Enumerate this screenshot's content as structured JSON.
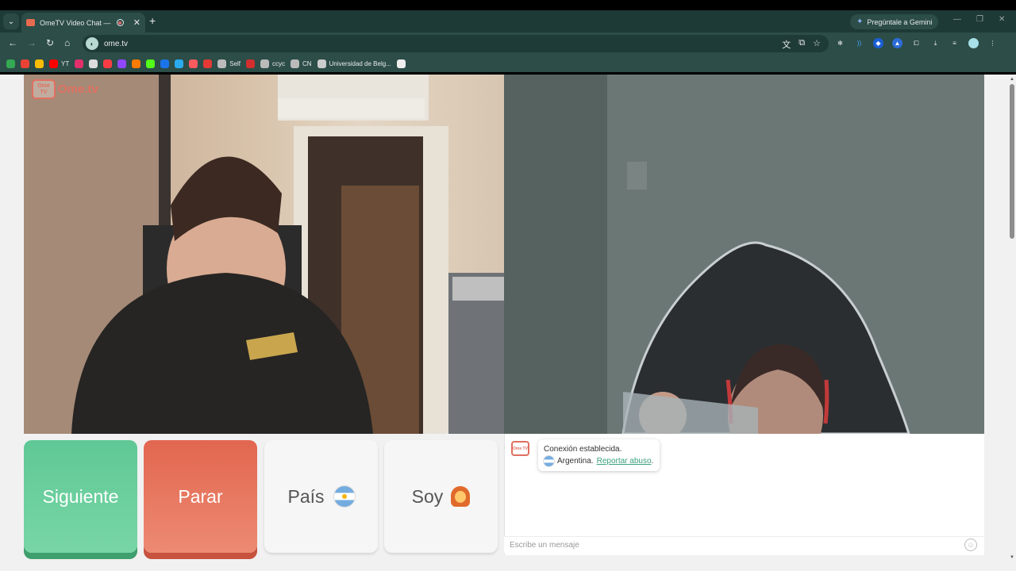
{
  "browser": {
    "tab_title": "OmeTV Video Chat — Ome",
    "new_tab_label": "+",
    "gemini_label": "Pregúntale a Gemini",
    "url": "ome.tv",
    "bookmarks": [
      {
        "label": "",
        "color": "#34a853"
      },
      {
        "label": "",
        "color": "#ea4335"
      },
      {
        "label": "",
        "color": "#fbbc04"
      },
      {
        "label": "YT",
        "color": "#ff0000"
      },
      {
        "label": "",
        "color": "#e1306c"
      },
      {
        "label": "",
        "color": "#dddddd"
      },
      {
        "label": "",
        "color": "#fc3c44"
      },
      {
        "label": "",
        "color": "#9146ff"
      },
      {
        "label": "",
        "color": "#ff7a00"
      },
      {
        "label": "",
        "color": "#53fc18"
      },
      {
        "label": "",
        "color": "#1a73e8"
      },
      {
        "label": "",
        "color": "#2aabee"
      },
      {
        "label": "",
        "color": "#ff5a5f"
      },
      {
        "label": "",
        "color": "#e53935"
      },
      {
        "label": "Self",
        "color": "#bbbbbb"
      },
      {
        "label": "",
        "color": "#d32f2f"
      },
      {
        "label": "ccyc",
        "color": "#bbbbbb"
      },
      {
        "label": "CN",
        "color": "#bbbbbb"
      },
      {
        "label": "Universidad de Belg...",
        "color": "#cccccc"
      },
      {
        "label": "",
        "color": "#eeeeee"
      }
    ]
  },
  "app": {
    "logo_text": "Ome.tv",
    "logo_badge": "Ome TV",
    "buttons": {
      "next": "Siguiente",
      "stop": "Parar",
      "country": "País",
      "soy": "Soy"
    },
    "chat": {
      "status": "Conexión establecida.",
      "country": "Argentina.",
      "report_link": "Reportar abuso",
      "report_suffix": ".",
      "input_placeholder": "Escribe un mensaje"
    }
  }
}
